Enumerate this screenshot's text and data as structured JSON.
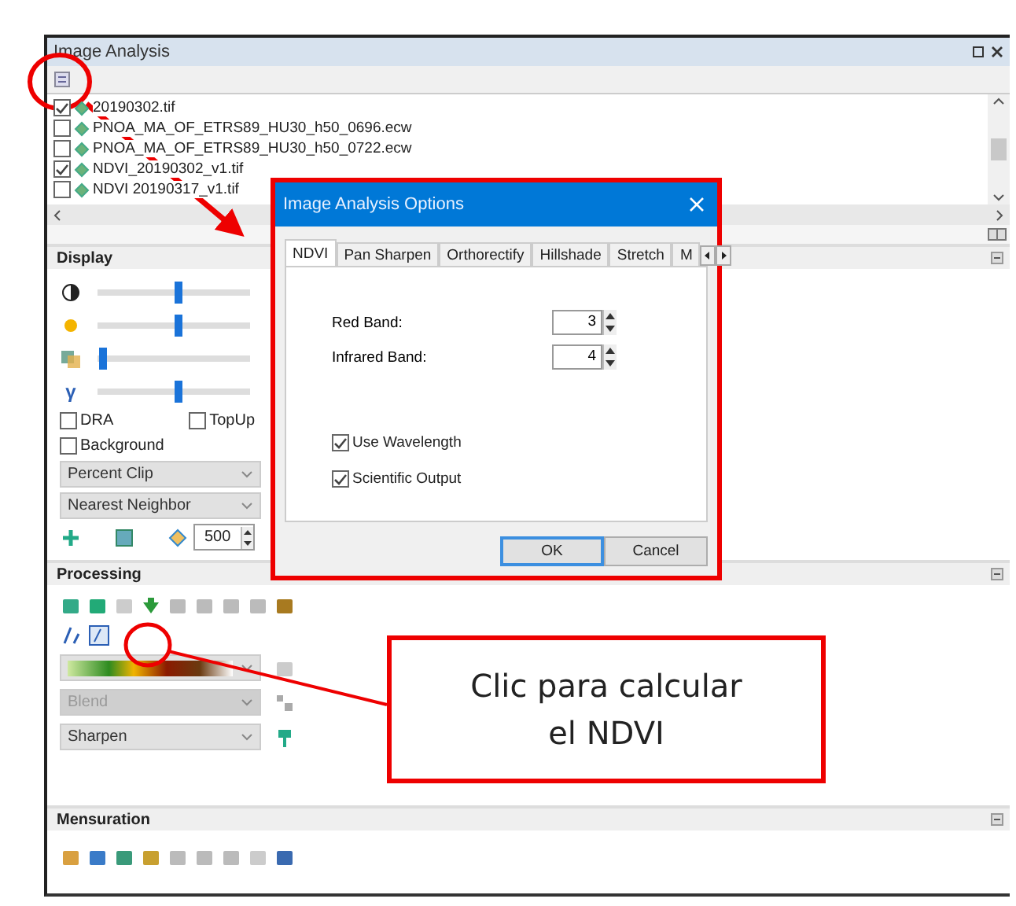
{
  "panel": {
    "title": "Image Analysis"
  },
  "layers": [
    {
      "name": "20190302.tif",
      "checked": true
    },
    {
      "name": "PNOA_MA_OF_ETRS89_HU30_h50_0696.ecw",
      "checked": false
    },
    {
      "name": "PNOA_MA_OF_ETRS89_HU30_h50_0722.ecw",
      "checked": false
    },
    {
      "name": "NDVI_20190302_v1.tif",
      "checked": true
    },
    {
      "name": "NDVI 20190317_v1.tif",
      "checked": false
    }
  ],
  "display": {
    "header": "Display",
    "sliders": [
      {
        "kind": "contrast",
        "level": 0.5
      },
      {
        "kind": "brightness",
        "level": 0.5
      },
      {
        "kind": "transparency",
        "level": 0.03
      },
      {
        "kind": "gamma",
        "symbol": "γ",
        "level": 0.5
      }
    ],
    "options": [
      {
        "label": "DRA",
        "checked": false
      },
      {
        "label": "TopUp",
        "checked": false
      },
      {
        "label": "Background",
        "checked": false
      }
    ],
    "stretch": "Percent Clip",
    "resampling": "Nearest Neighbor",
    "scale": "500"
  },
  "processing": {
    "header": "Processing",
    "blend": {
      "value": "Blend",
      "disabled": true
    },
    "sharpen": {
      "value": "Sharpen",
      "disabled": false
    }
  },
  "mensuration": {
    "header": "Mensuration"
  },
  "dialog": {
    "title": "Image Analysis Options",
    "tabs": [
      {
        "label": "NDVI",
        "selected": true
      },
      {
        "label": "Pan Sharpen",
        "selected": false
      },
      {
        "label": "Orthorectify",
        "selected": false
      },
      {
        "label": "Hillshade",
        "selected": false
      },
      {
        "label": "Stretch",
        "selected": false
      },
      {
        "label": "M",
        "selected": false
      }
    ],
    "fields": [
      {
        "label": "Red Band:",
        "value": "3"
      },
      {
        "label": "Infrared Band:",
        "value": "4"
      }
    ],
    "checks": [
      {
        "label": "Use Wavelength",
        "checked": true
      },
      {
        "label": "Scientific Output",
        "checked": true
      }
    ],
    "buttons": [
      {
        "label": "OK",
        "default": true
      },
      {
        "label": "Cancel",
        "default": false
      }
    ]
  },
  "callout": {
    "text": "Clic para calcular el NDVI"
  }
}
